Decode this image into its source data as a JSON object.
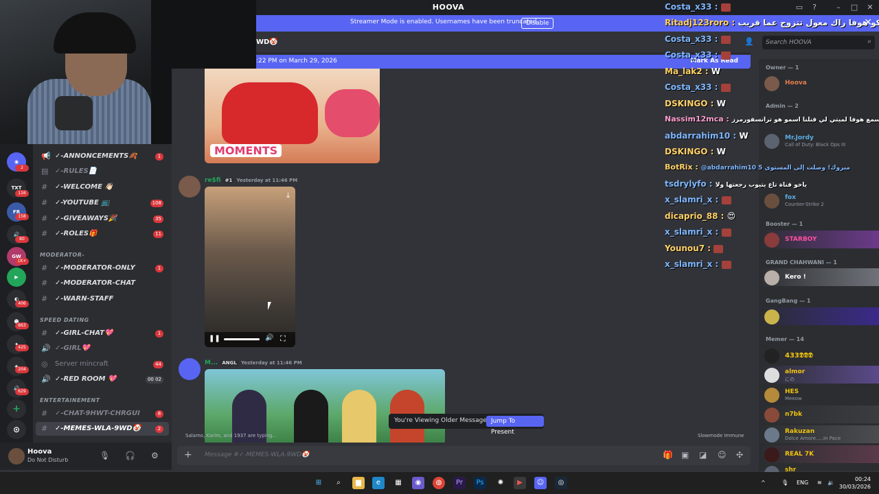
{
  "window": {
    "title": "HOOVA"
  },
  "banner": {
    "text": "Streamer Mode is enabled. Usernames have been truncated.",
    "button": "Disable"
  },
  "channel_header": {
    "name": "WD🤡"
  },
  "new_messages_bar": {
    "text": ":22 PM on March 29, 2026",
    "mark": "Mark As Read"
  },
  "server_rail": {
    "badges": [
      "2",
      "116",
      "158",
      "80",
      "1K+",
      "406",
      "863",
      "425",
      "204",
      "629"
    ]
  },
  "channels": [
    {
      "icon": "📢",
      "label": "✓-ANNONCEMENTS🍂",
      "count": "1"
    },
    {
      "icon": "▤",
      "label": "✓-RULES📄",
      "count": ""
    },
    {
      "icon": "#",
      "label": "✓-WELCOME 👋🏻",
      "count": ""
    },
    {
      "icon": "#",
      "label": "✓-YOUTUBE 📺",
      "count": "108"
    },
    {
      "icon": "#",
      "label": "✓-GIVEAWAYS🎉",
      "count": "35"
    },
    {
      "icon": "#",
      "label": "✓-ROLES🎁",
      "count": "11"
    },
    {
      "icon": "#",
      "label": "✓-MODERATOR-ONLY",
      "count": "1"
    },
    {
      "icon": "#",
      "label": "✓-MODERATOR-CHAT",
      "count": ""
    },
    {
      "icon": "#",
      "label": "✓-WARN-STAFF",
      "count": ""
    },
    {
      "icon": "#",
      "label": "✓-GIRL-CHAT💖",
      "count": "1"
    },
    {
      "icon": "🔊",
      "label": "✓-GIRL💖",
      "count": ""
    },
    {
      "icon": "◎",
      "label": "Server mincraft",
      "count": "44"
    },
    {
      "icon": "🔊",
      "label": "✓-RED ROOM 💖",
      "count": "00 02"
    },
    {
      "icon": "#",
      "label": "✓-CHAT-9HWT-CHRGUI",
      "count": "8"
    },
    {
      "icon": "#",
      "label": "✓-MEMES-WLA-9WD🤡",
      "count": "2"
    }
  ],
  "categories": [
    "MODERATOR-",
    "SPEED DATING",
    "ENTERTAINEMENT"
  ],
  "user_panel": {
    "name": "Hoova",
    "status": "Do Not Disturb"
  },
  "messages": {
    "image1_label": "MOMENTS",
    "msg2": {
      "author": "re$fi",
      "tag": "#1",
      "time": "Yesterday at 11:46 PM"
    },
    "msg3": {
      "author": "M...",
      "tag": "ANGL",
      "time": "Yesterday at 11:46 PM"
    }
  },
  "older_messages": {
    "text": "You're Viewing Older Messages",
    "button": "Jump To Present"
  },
  "typing": "Salamo, Karim, and 1937 are typing...",
  "slowmode": "Slowmode Immune",
  "composer": {
    "placeholder": "Message #✓-MEMES-WLA-9WD🤡"
  },
  "chat_overlay": [
    {
      "user": "Costa_x33 :",
      "msg": ""
    },
    {
      "user": "Ritadj123roro :",
      "msg": "اسكو هوفا راك معول تتزوج عما قريب"
    },
    {
      "user": "Costa_x33 :",
      "msg": ""
    },
    {
      "user": "Costa_x33 :",
      "msg": ""
    },
    {
      "user": "Ma_lak2 :",
      "msg": "W"
    },
    {
      "user": "Costa_x33 :",
      "msg": ""
    },
    {
      "user": "DSKINGO :",
      "msg": "W"
    },
    {
      "user": "Nassim12mca :",
      "msg": "اسمع هوفا لميتي لي قتلنا اسمو هو ترانسفورمرز"
    },
    {
      "user": "abdarrahim10 :",
      "msg": "W"
    },
    {
      "user": "DSKINGO :",
      "msg": "W"
    },
    {
      "user": "BotRix :",
      "msg": "@abdarrahim10 مبروك! وصلت إلى المستوى 5"
    },
    {
      "user": "tsdrylyfo :",
      "msg": "ياخو قناة تاع يتيوب رجعتها ولا"
    },
    {
      "user": "x_slamri_x :",
      "msg": ""
    },
    {
      "user": "dicaprio_88 :",
      "msg": "😍"
    },
    {
      "user": "x_slamri_x :",
      "msg": ""
    },
    {
      "user": "Younou7 :",
      "msg": ""
    },
    {
      "user": "x_slamri_x :",
      "msg": ""
    }
  ],
  "search": {
    "placeholder": "Search HOOVA"
  },
  "member_groups": [
    {
      "title": "Owner — 1",
      "members": [
        {
          "name": "Hoova",
          "activity": ""
        }
      ]
    },
    {
      "title": "Admin — 2",
      "members": [
        {
          "name": "Mr.Jordy",
          "activity": "Call of Duty: Black Ops III"
        }
      ]
    },
    {
      "title": "",
      "members": [
        {
          "name": "fox",
          "activity": "Counter-Strike 2"
        }
      ]
    },
    {
      "title": "Booster — 1",
      "members": [
        {
          "name": "STARBOY",
          "activity": ""
        }
      ]
    },
    {
      "title": "GRAND CHAHWANI — 1",
      "members": [
        {
          "name": "Kero !",
          "activity": ""
        }
      ]
    },
    {
      "title": "GangBang — 1",
      "members": [
        {
          "name": "",
          "activity": ""
        }
      ]
    },
    {
      "title": "Memer — 14",
      "members": [
        {
          "name": "433𝕯𝕯𝕯",
          "activity": ""
        },
        {
          "name": "almor",
          "activity": "にの"
        },
        {
          "name": "HES",
          "activity": "Meeow"
        },
        {
          "name": "n7bk",
          "activity": ""
        },
        {
          "name": "Rakuzan",
          "activity": "Dolce Amore.....In Pace"
        },
        {
          "name": "REAL 7K",
          "activity": ""
        },
        {
          "name": "shr",
          "activity": ""
        }
      ]
    }
  ],
  "taskbar": {
    "lang": "ENG",
    "time": "00:24",
    "date": "30/03/2026"
  },
  "colors": {
    "accent": "#5865f2",
    "danger": "#da373c",
    "chat_user": "#7fb7ff"
  }
}
